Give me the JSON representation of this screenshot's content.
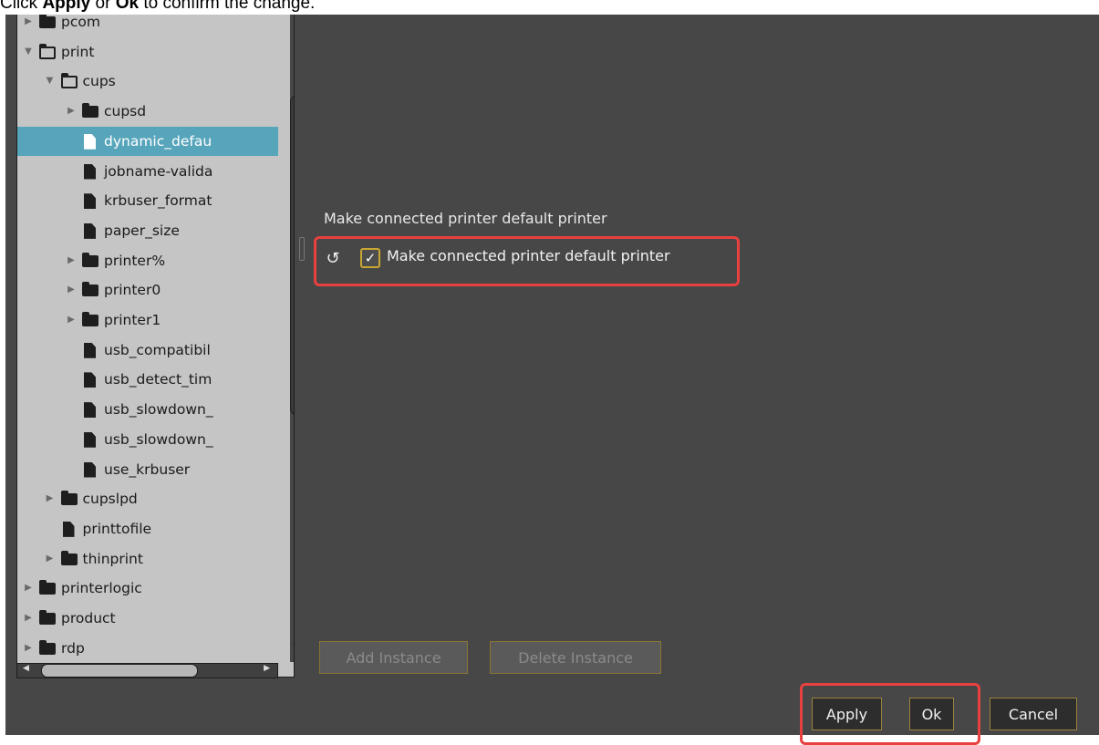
{
  "instruction": {
    "prefix": "Click ",
    "apply_word": "Apply",
    "middle": " or ",
    "ok_word": "Ok",
    "suffix": " to confirm the change."
  },
  "tree": [
    {
      "label": "pcom",
      "kind": "folder",
      "expanded": false,
      "depth": 1
    },
    {
      "label": "print",
      "kind": "folder",
      "expanded": true,
      "depth": 1
    },
    {
      "label": "cups",
      "kind": "folder",
      "expanded": true,
      "depth": 2
    },
    {
      "label": "cupsd",
      "kind": "folder",
      "expanded": false,
      "depth": 3
    },
    {
      "label": "dynamic_defau",
      "kind": "file",
      "depth": 3,
      "selected": true
    },
    {
      "label": "jobname-valida",
      "kind": "file",
      "depth": 3
    },
    {
      "label": "krbuser_format",
      "kind": "file",
      "depth": 3
    },
    {
      "label": "paper_size",
      "kind": "file",
      "depth": 3
    },
    {
      "label": "printer%",
      "kind": "folder",
      "expanded": false,
      "depth": 3
    },
    {
      "label": "printer0",
      "kind": "folder",
      "expanded": false,
      "depth": 3
    },
    {
      "label": "printer1",
      "kind": "folder",
      "expanded": false,
      "depth": 3
    },
    {
      "label": "usb_compatibil",
      "kind": "file",
      "depth": 3
    },
    {
      "label": "usb_detect_tim",
      "kind": "file",
      "depth": 3
    },
    {
      "label": "usb_slowdown_",
      "kind": "file",
      "depth": 3
    },
    {
      "label": "usb_slowdown_",
      "kind": "file",
      "depth": 3
    },
    {
      "label": "use_krbuser",
      "kind": "file",
      "depth": 3
    },
    {
      "label": "cupslpd",
      "kind": "folder",
      "expanded": false,
      "depth": 2
    },
    {
      "label": "printtofile",
      "kind": "file",
      "depth": 2
    },
    {
      "label": "thinprint",
      "kind": "folder",
      "expanded": false,
      "depth": 2
    },
    {
      "label": "printerlogic",
      "kind": "folder",
      "expanded": false,
      "depth": 1
    },
    {
      "label": "product",
      "kind": "folder",
      "expanded": false,
      "depth": 1
    },
    {
      "label": "rdp",
      "kind": "folder",
      "expanded": false,
      "depth": 1
    }
  ],
  "setting": {
    "section_title": "Make connected printer default printer",
    "checkbox_label": "Make connected printer default printer",
    "checked": true,
    "checkmark": "✓",
    "reset_glyph": "↺"
  },
  "buttons": {
    "add_instance": "Add Instance",
    "delete_instance": "Delete Instance",
    "apply": "Apply",
    "ok": "Ok",
    "cancel": "Cancel"
  },
  "colors": {
    "dialog_bg": "#474747",
    "tree_bg": "#c5c5c5",
    "selection": "#57a5bb",
    "highlight_box": "#e8403f",
    "checkbox_border": "#c9a632"
  }
}
